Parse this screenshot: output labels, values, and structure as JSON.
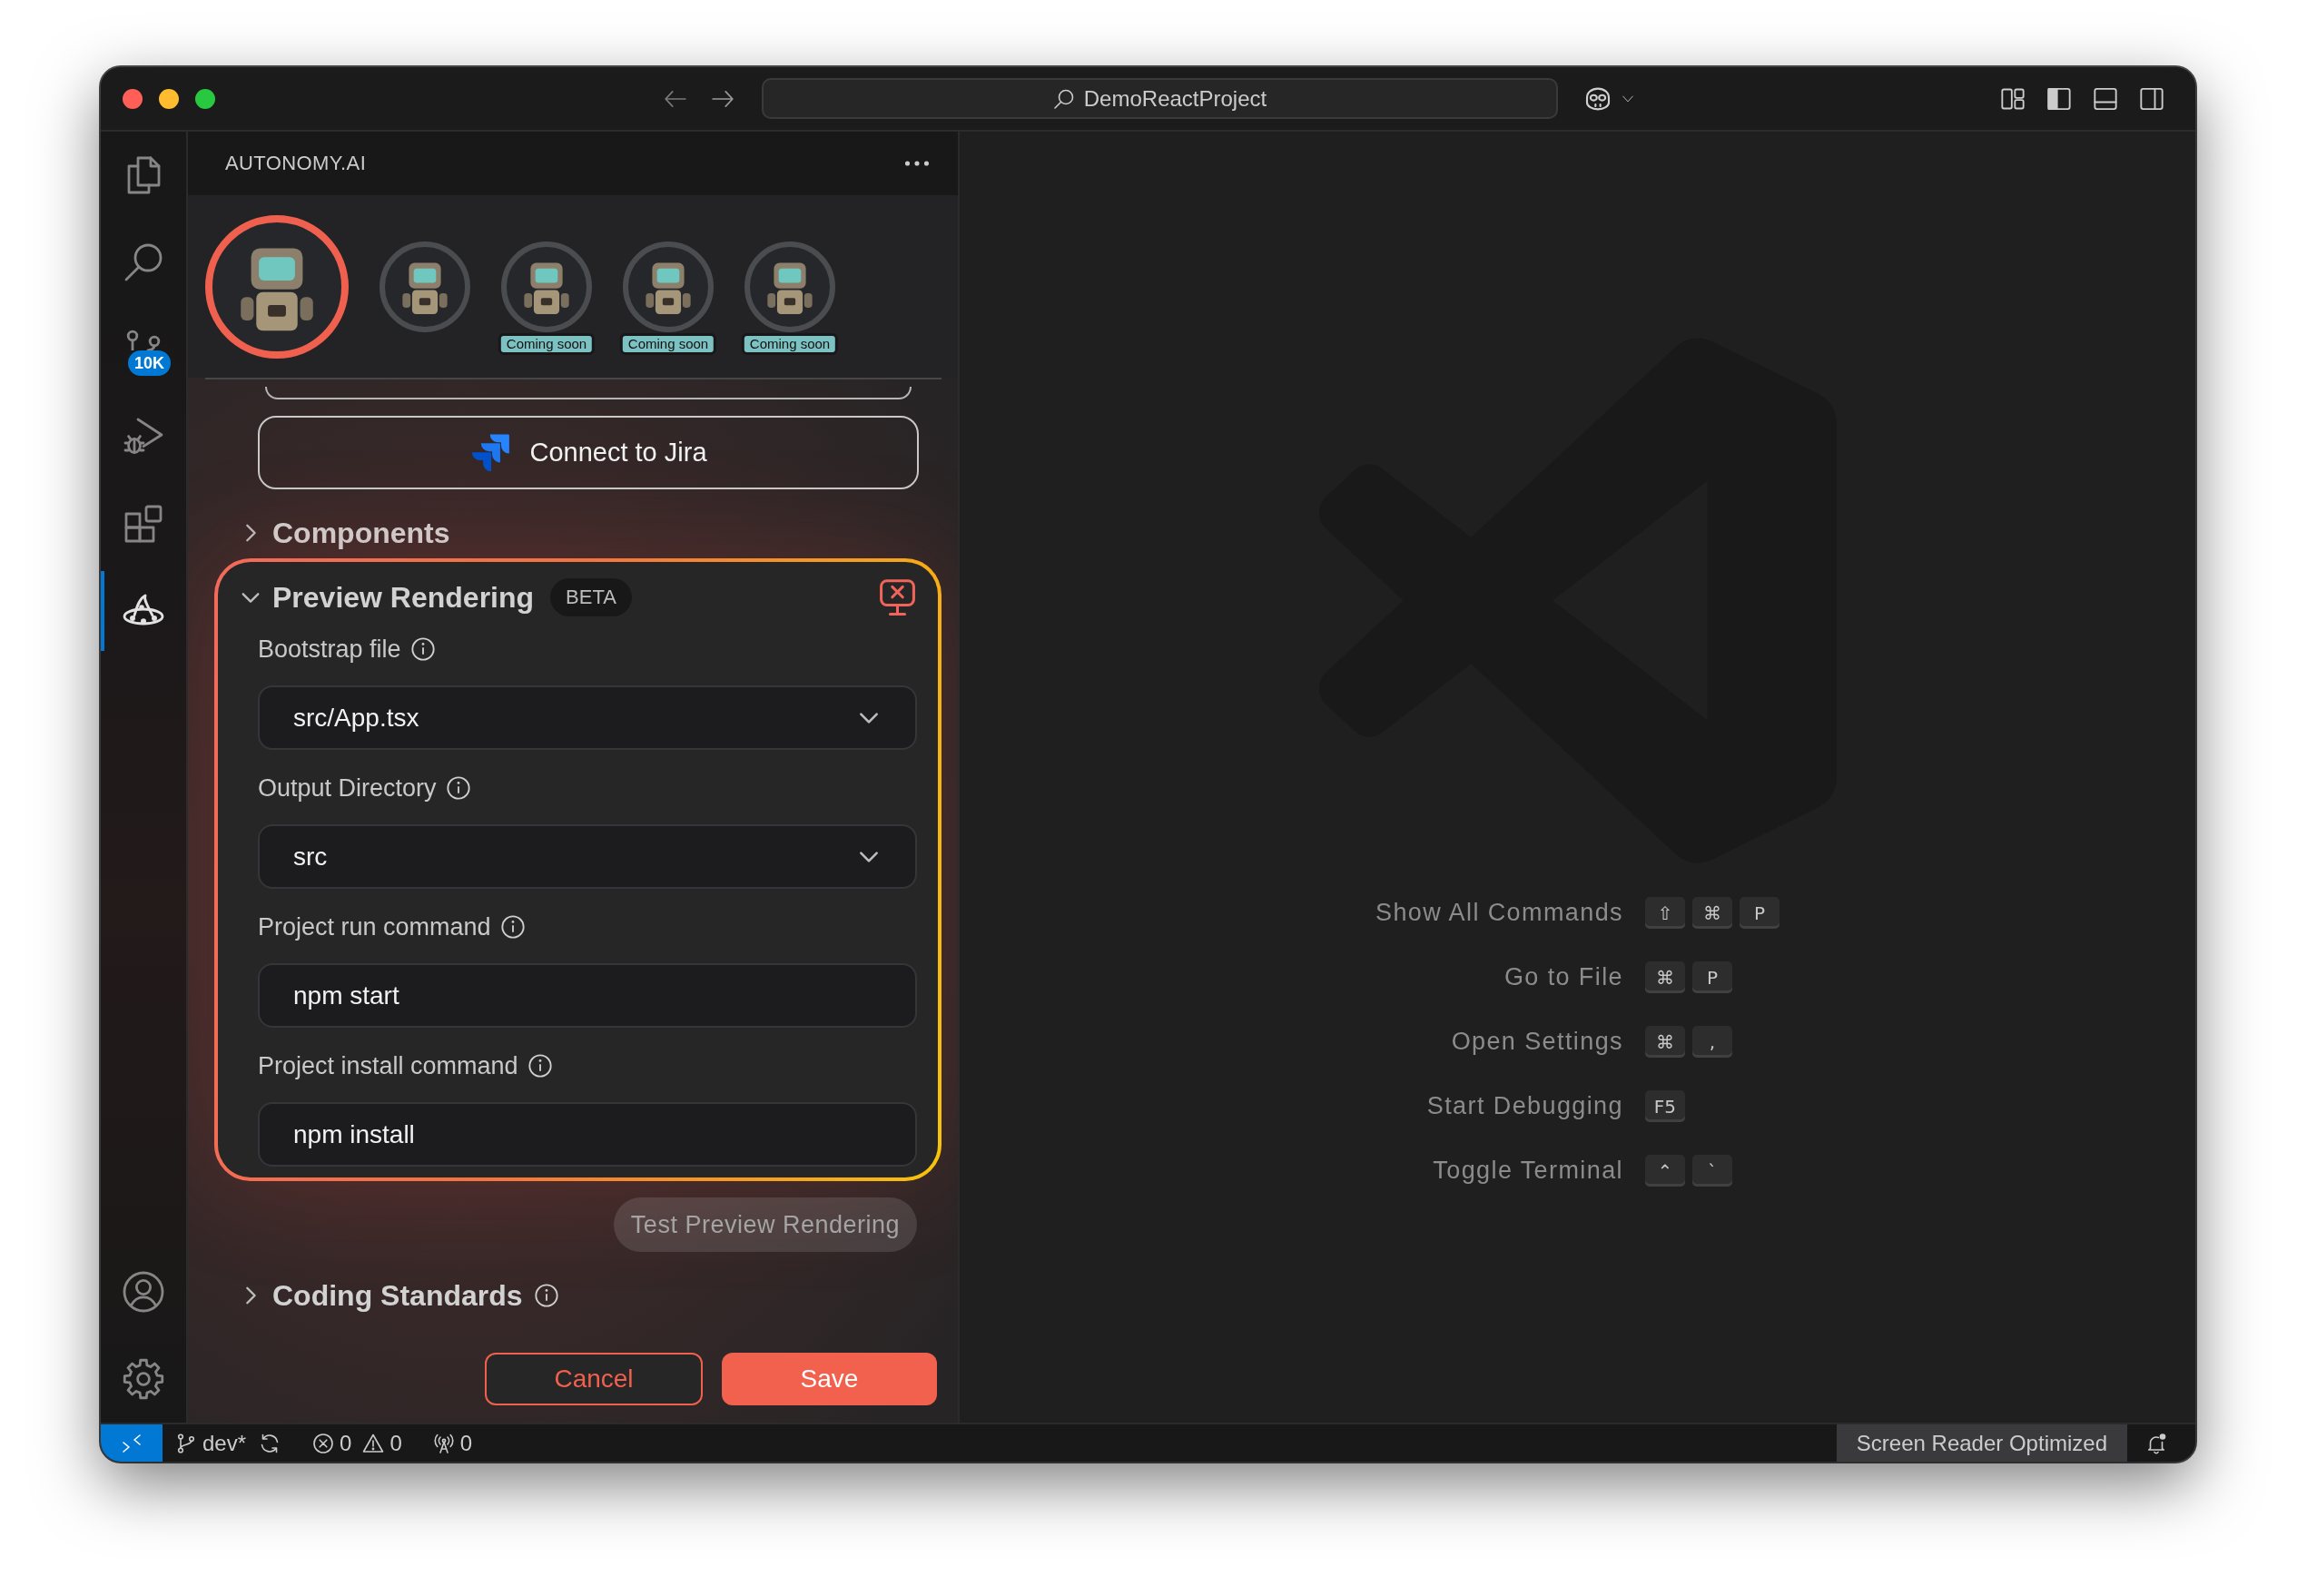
{
  "window": {
    "title": "DemoReactProject"
  },
  "activity_bar": {
    "items": [
      {
        "kind": "files",
        "selected": false
      },
      {
        "kind": "search",
        "selected": false
      },
      {
        "kind": "source_control",
        "selected": false,
        "badge": "10K"
      },
      {
        "kind": "run_debug",
        "selected": false
      },
      {
        "kind": "extensions",
        "selected": false
      },
      {
        "kind": "autonomy",
        "selected": true
      }
    ],
    "bottom_items": [
      {
        "kind": "account"
      },
      {
        "kind": "settings"
      }
    ]
  },
  "sidebar": {
    "title": "AUTONOMY.AI",
    "agents": [
      {
        "selected": true
      },
      {
        "selected": false
      },
      {
        "selected": false,
        "badge": "Coming soon"
      },
      {
        "selected": false,
        "badge": "Coming soon"
      },
      {
        "selected": false,
        "badge": "Coming soon"
      }
    ],
    "connect_button": "Connect to Jira",
    "sections": [
      {
        "title": "Components",
        "expanded": false,
        "info": false
      },
      {
        "title": "Preview Rendering",
        "expanded": true,
        "info": false,
        "badge": "BETA",
        "fields": [
          {
            "label": "Bootstrap file",
            "kind": "select",
            "value": "src/App.tsx"
          },
          {
            "label": "Output Directory",
            "kind": "select",
            "value": "src"
          },
          {
            "label": "Project run command",
            "kind": "text",
            "value": "npm start"
          },
          {
            "label": "Project install command",
            "kind": "text",
            "value": "npm install"
          }
        ],
        "action": {
          "label": "Test Preview Rendering",
          "disabled": true
        }
      },
      {
        "title": "Coding Standards",
        "expanded": false,
        "info": true
      }
    ],
    "buttons": [
      {
        "label": "Cancel",
        "kind": "secondary"
      },
      {
        "label": "Save",
        "kind": "primary"
      }
    ]
  },
  "editor": {
    "shortcuts": [
      {
        "label": "Show All Commands",
        "keys": [
          "⇧",
          "⌘",
          "P"
        ]
      },
      {
        "label": "Go to File",
        "keys": [
          "⌘",
          "P"
        ]
      },
      {
        "label": "Open Settings",
        "keys": [
          "⌘",
          ","
        ]
      },
      {
        "label": "Start Debugging",
        "keys": [
          "F5"
        ]
      },
      {
        "label": "Toggle Terminal",
        "keys": [
          "⌃",
          "`"
        ]
      }
    ]
  },
  "status_bar": {
    "branch": "dev*",
    "errors": "0",
    "warnings": "0",
    "ports": "0",
    "mode": "Screen Reader Optimized"
  }
}
